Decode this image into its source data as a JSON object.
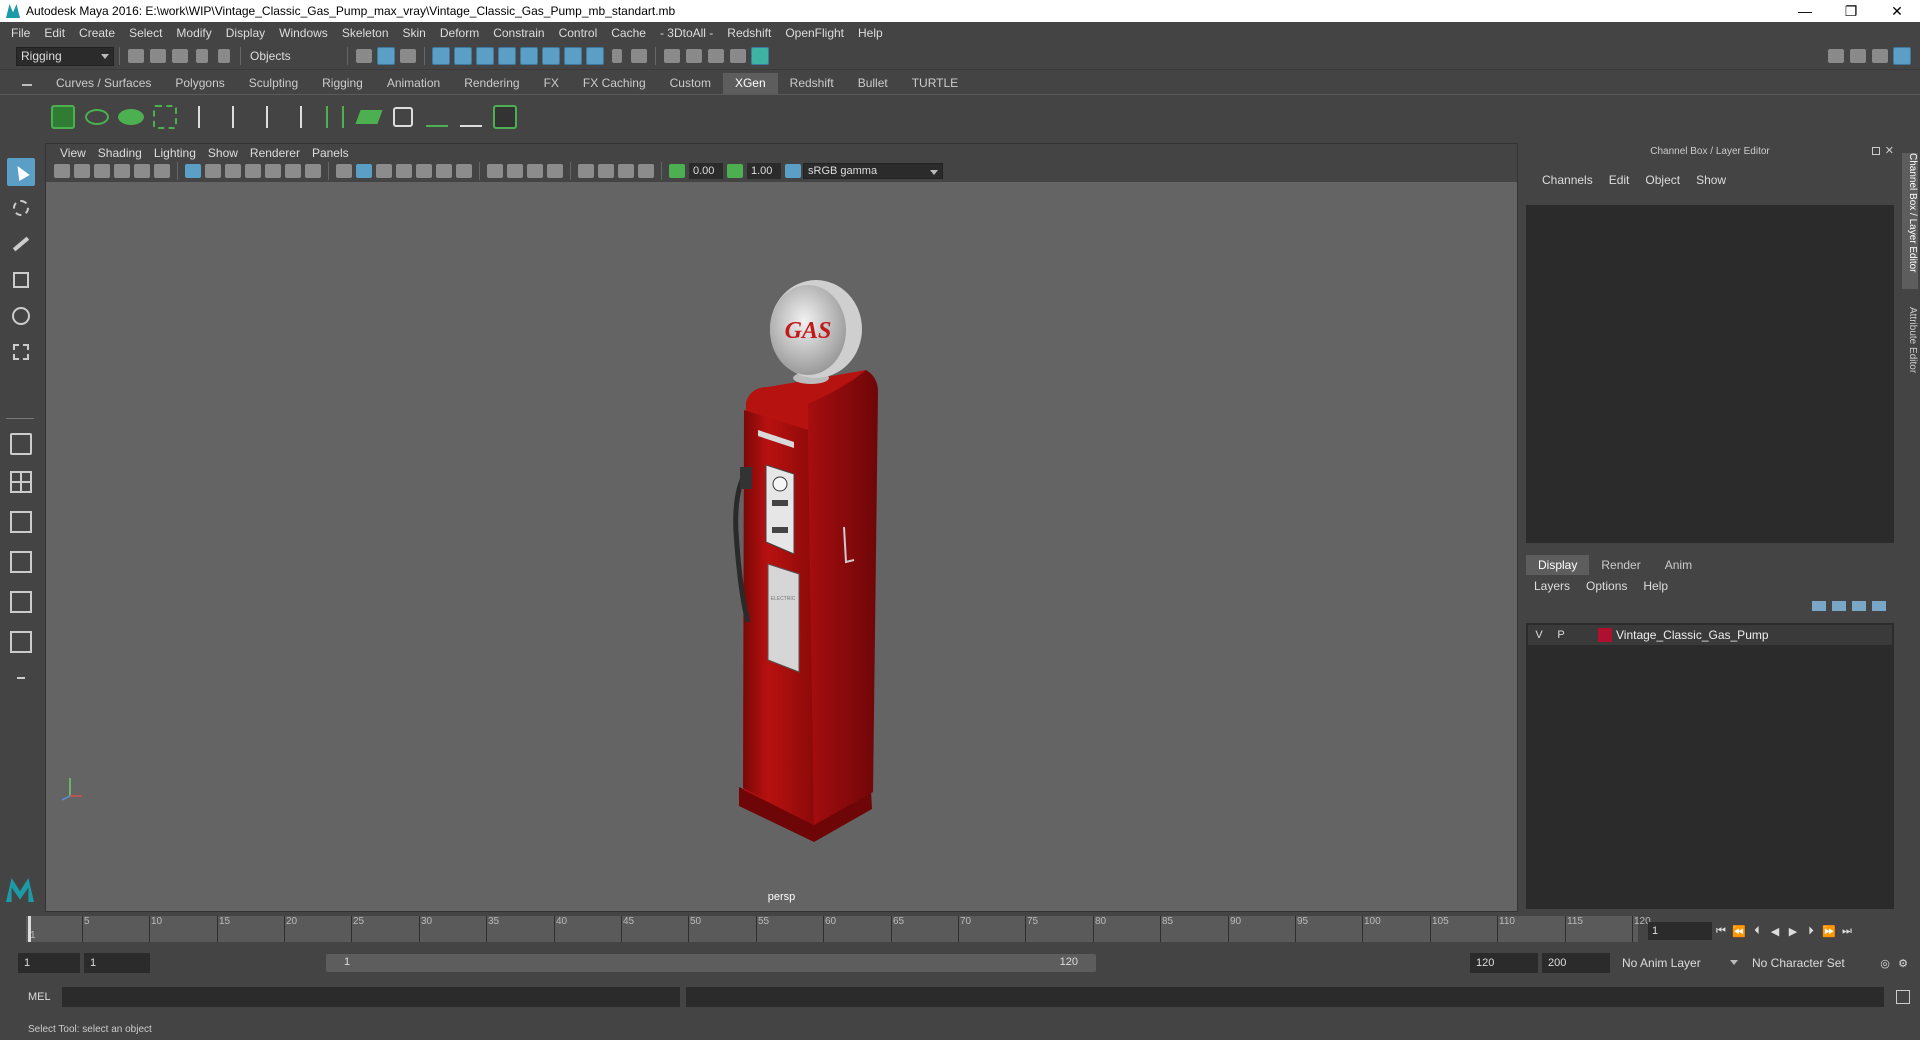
{
  "window": {
    "title": "Autodesk Maya 2016: E:\\work\\WIP\\Vintage_Classic_Gas_Pump_max_vray\\Vintage_Classic_Gas_Pump_mb_standart.mb",
    "minimize": "—",
    "restore": "❐",
    "close": "✕"
  },
  "menus": [
    "File",
    "Edit",
    "Create",
    "Select",
    "Modify",
    "Display",
    "Windows",
    "Skeleton",
    "Skin",
    "Deform",
    "Constrain",
    "Control",
    "Cache",
    "- 3DtoAll -",
    "Redshift",
    "OpenFlight",
    "Help"
  ],
  "status_line": {
    "mode": "Rigging",
    "selection_mask": "Objects"
  },
  "shelf_tabs": [
    "Curves / Surfaces",
    "Polygons",
    "Sculpting",
    "Rigging",
    "Animation",
    "Rendering",
    "FX",
    "FX Caching",
    "Custom",
    "XGen",
    "Redshift",
    "Bullet",
    "TURTLE"
  ],
  "active_shelf_tab": "XGen",
  "viewport": {
    "menus": [
      "View",
      "Shading",
      "Lighting",
      "Show",
      "Renderer",
      "Panels"
    ],
    "exposure": "0.00",
    "gamma": "1.00",
    "color_space": "sRGB gamma",
    "camera_label": "persp",
    "sign_text": "GAS",
    "panel_text": "ELECTRIC"
  },
  "right_panel": {
    "title": "Channel Box / Layer Editor",
    "channel_menus": [
      "Channels",
      "Edit",
      "Object",
      "Show"
    ],
    "layer_tabs": [
      "Display",
      "Render",
      "Anim"
    ],
    "active_layer_tab": "Display",
    "layer_menus": [
      "Layers",
      "Options",
      "Help"
    ],
    "layers": [
      {
        "v": "V",
        "p": "P",
        "name": "Vintage_Classic_Gas_Pump",
        "color": "#b01030"
      }
    ]
  },
  "side_tabs": [
    "Channel Box / Layer Editor",
    "Attribute Editor"
  ],
  "timeline": {
    "ticks": [
      "1",
      "5",
      "10",
      "15",
      "20",
      "25",
      "30",
      "35",
      "40",
      "45",
      "50",
      "55",
      "60",
      "65",
      "70",
      "75",
      "80",
      "85",
      "90",
      "95",
      "100",
      "105",
      "110",
      "115",
      "120"
    ],
    "current_frame": "1"
  },
  "range": {
    "start": "1",
    "inner_start": "1",
    "slider_start": "1",
    "slider_end": "120",
    "end": "120",
    "max_end": "200",
    "anim_layer": "No Anim Layer",
    "character_set": "No Character Set"
  },
  "command_line": {
    "label": "MEL"
  },
  "help_line": {
    "text": "Select Tool: select an object"
  },
  "colors": {
    "pump_red": "#a80e10",
    "accent_blue": "#5b9fc7",
    "layer_color": "#b01030"
  }
}
